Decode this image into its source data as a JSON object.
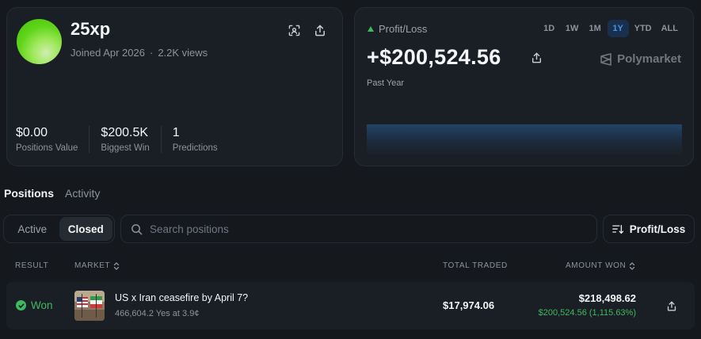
{
  "profile": {
    "username": "25xp",
    "joined": "Joined Apr 2026",
    "separator": "·",
    "views": "2.2K views",
    "stats": [
      {
        "value": "$0.00",
        "label": "Positions Value"
      },
      {
        "value": "$200.5K",
        "label": "Biggest Win"
      },
      {
        "value": "1",
        "label": "Predictions"
      }
    ],
    "avatar_color": "#5fd41a"
  },
  "pl": {
    "label": "Profit/Loss",
    "value": "+$200,524.56",
    "period": "Past Year",
    "brand": "Polymarket",
    "ranges": [
      "1D",
      "1W",
      "1M",
      "1Y",
      "YTD",
      "ALL"
    ],
    "active_range": "1Y",
    "positive_color": "#3fb95f",
    "accent_color": "#4a90e2"
  },
  "tabs": [
    {
      "label": "Positions"
    },
    {
      "label": "Activity"
    }
  ],
  "filter": {
    "active_label": "Active",
    "closed_label": "Closed"
  },
  "search": {
    "placeholder": "Search positions"
  },
  "sort": {
    "label": "Profit/Loss"
  },
  "table": {
    "headers": {
      "result": "RESULT",
      "market": "MARKET",
      "total_traded": "TOTAL TRADED",
      "amount_won": "AMOUNT WON"
    },
    "rows": [
      {
        "result": "Won",
        "market": "US x Iran ceasefire by April 7?",
        "details": "466,604.2 Yes at 3.9¢",
        "total_traded": "$17,974.06",
        "amount_won": "$218,498.62",
        "profit": "$200,524.56 (1,115.63%)"
      }
    ]
  }
}
